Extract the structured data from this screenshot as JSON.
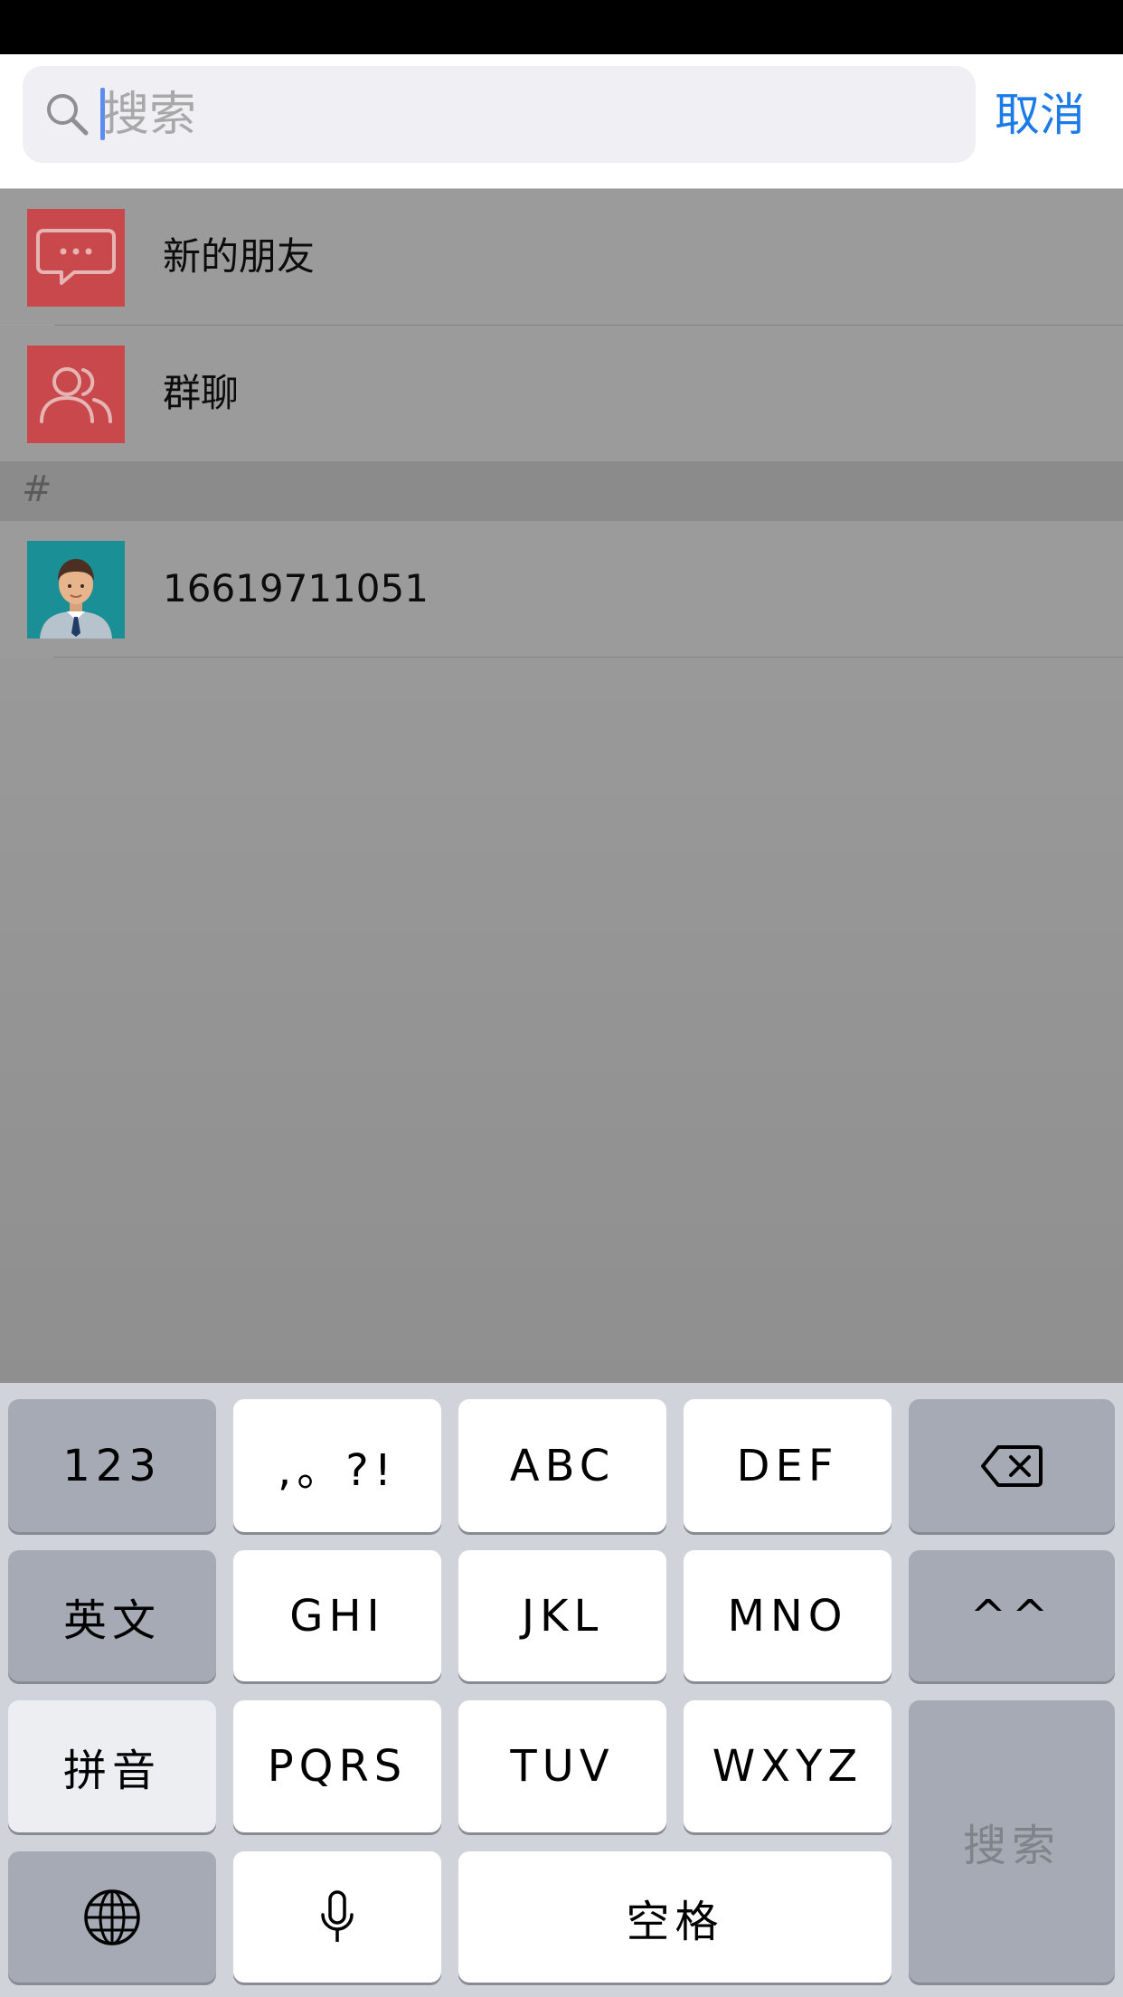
{
  "search": {
    "placeholder": "搜索",
    "cancel_label": "取消"
  },
  "contacts": {
    "special_items": [
      {
        "label": "新的朋友",
        "icon": "message-bubble-icon"
      },
      {
        "label": "群聊",
        "icon": "group-icon"
      }
    ],
    "sections": [
      {
        "header": "#",
        "items": [
          {
            "label": "16619711051",
            "icon": "avatar"
          }
        ]
      }
    ]
  },
  "keyboard": {
    "row1": [
      "123",
      ",。?!",
      "ABC",
      "DEF"
    ],
    "row2": [
      "英文",
      "GHI",
      "JKL",
      "MNO",
      "^^"
    ],
    "row3": [
      "拼音",
      "PQRS",
      "TUV",
      "WXYZ"
    ],
    "row4_space": "空格",
    "search_key": "搜索",
    "icons": [
      "delete-icon",
      "globe-icon",
      "microphone-icon"
    ]
  },
  "colors": {
    "accent": "#1d7be8",
    "item_icon_red": "#c9484b",
    "avatar_teal": "#1b8f96"
  }
}
